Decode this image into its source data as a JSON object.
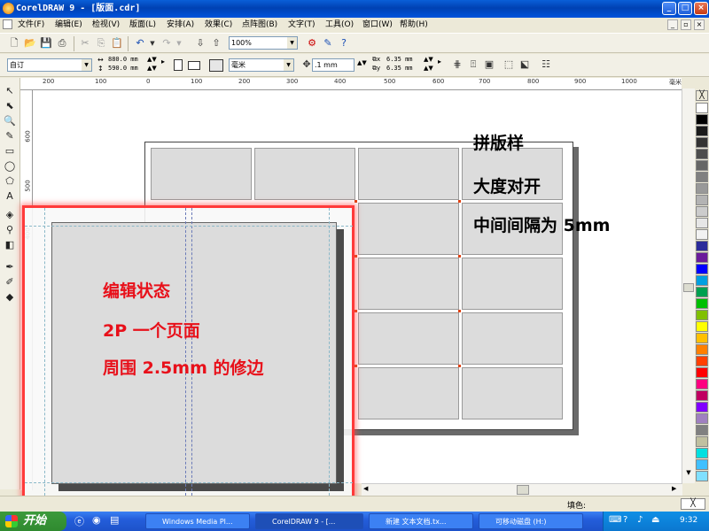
{
  "window": {
    "title": "CorelDRAW 9 - [版面.cdr]",
    "minimize": "_",
    "maximize": "□",
    "close": "×"
  },
  "menu": [
    "文件(F)",
    "编辑(E)",
    "检视(V)",
    "版面(L)",
    "安排(A)",
    "效果(C)",
    "点阵图(B)",
    "文字(T)",
    "工具(O)",
    "窗口(W)",
    "帮助(H)"
  ],
  "toolbar": {
    "zoom": "100%"
  },
  "property_bar": {
    "preset": "自订",
    "width": "880.0 mm",
    "height": "590.0 mm",
    "units": "毫米",
    "nudge": ".1 mm",
    "dup_x": "6.35 mm",
    "dup_y": "6.35 mm"
  },
  "ruler_h": {
    "labels": [
      "200",
      "100",
      "0",
      "100",
      "200",
      "300",
      "400",
      "500",
      "600",
      "700",
      "800",
      "900",
      "1000"
    ],
    "unit": "毫米"
  },
  "ruler_v": {
    "labels": [
      "600",
      "500",
      "400"
    ]
  },
  "canvas": {
    "right_text": [
      "拼版样",
      "大度对开",
      "中间间隔为 5mm"
    ],
    "left_text": [
      "编辑状态",
      "2P 一个页面",
      "周围 2.5mm 的修边"
    ]
  },
  "palette_colors": [
    "#ffffff",
    "#000000",
    "#1a1a1a",
    "#333333",
    "#4d4d4d",
    "#666666",
    "#808080",
    "#999999",
    "#b3b3b3",
    "#cccccc",
    "#e6e6e6",
    "#f2f2f2",
    "#2b2b9a",
    "#6a1b9a",
    "#0000ff",
    "#00a0e0",
    "#00a050",
    "#00c000",
    "#80c000",
    "#ffff00",
    "#ffc000",
    "#ff8000",
    "#ff4000",
    "#ff0000",
    "#ff0080",
    "#c00060",
    "#8000ff",
    "#a080c0",
    "#808080",
    "#c0c0a0",
    "#00e0e0",
    "#40c0ff",
    "#80e0ff"
  ],
  "status": {
    "fill_label": "填色:"
  },
  "taskbar": {
    "start": "开始",
    "items": [
      "Windows Media Pl...",
      "CorelDRAW 9 - [...",
      "新建 文本文档.tx...",
      "可移动磁盘 (H:)"
    ],
    "clock": "9:32"
  }
}
